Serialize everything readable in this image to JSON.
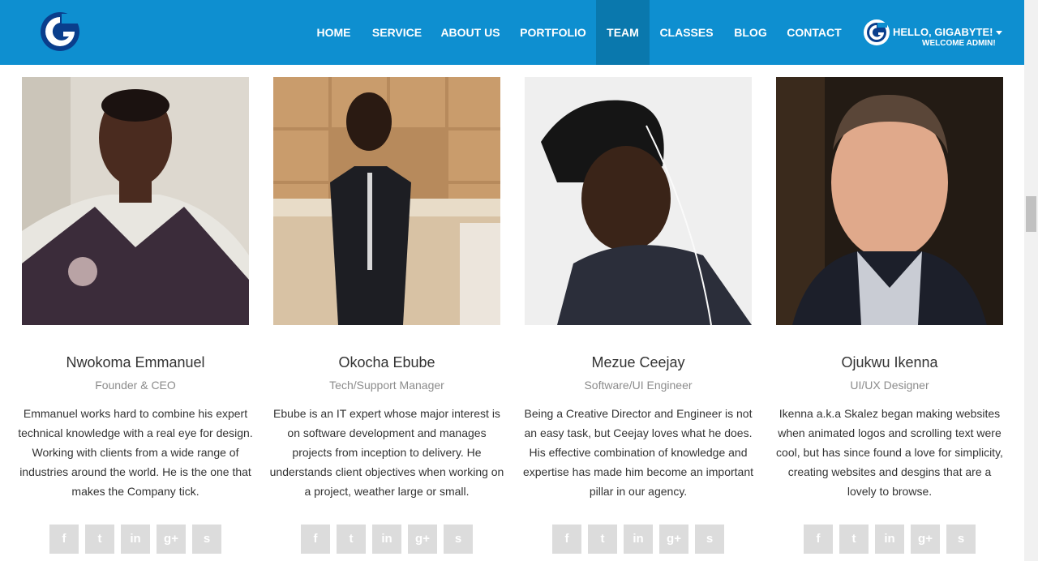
{
  "nav": {
    "items": [
      {
        "label": "HOME",
        "active": false
      },
      {
        "label": "SERVICE",
        "active": false
      },
      {
        "label": "ABOUT US",
        "active": false
      },
      {
        "label": "PORTFOLIO",
        "active": false
      },
      {
        "label": "TEAM",
        "active": true
      },
      {
        "label": "CLASSES",
        "active": false
      },
      {
        "label": "BLOG",
        "active": false
      },
      {
        "label": "CONTACT",
        "active": false
      }
    ],
    "user_hello": "HELLO, GIGABYTE!",
    "user_welcome": "WELCOME ADMIN!"
  },
  "colors": {
    "navbar": "#0e8fd0",
    "active_tab": "#0a78ad",
    "social_bg": "#dcdcdc"
  },
  "team": [
    {
      "name": "Nwokoma Emmanuel",
      "role": "Founder & CEO",
      "bio": "Emmanuel works hard to combine his expert technical knowledge with a real eye for design. Working with clients from a wide range of industries around the world. He is the one that makes the Company tick."
    },
    {
      "name": "Okocha Ebube",
      "role": "Tech/Support Manager",
      "bio": "Ebube is an IT expert whose major interest is on software development and manages projects from inception to delivery. He understands client objectives when working on a project, weather large or small."
    },
    {
      "name": "Mezue Ceejay",
      "role": "Software/UI Engineer",
      "bio": "Being a Creative Director and Engineer is not an easy task, but Ceejay loves what he does. His effective combination of knowledge and expertise has made him become an important pillar in our agency."
    },
    {
      "name": "Ojukwu Ikenna",
      "role": "UI/UX Designer",
      "bio": "Ikenna a.k.a Skalez began making websites when animated logos and scrolling text were cool, but has since found a love for simplicity, creating websites and desgins that are a lovely to browse."
    }
  ],
  "social_icons": [
    {
      "icon": "facebook-icon",
      "glyph": "f"
    },
    {
      "icon": "twitter-icon",
      "glyph": "t"
    },
    {
      "icon": "linkedin-icon",
      "glyph": "in"
    },
    {
      "icon": "google-plus-icon",
      "glyph": "g+"
    },
    {
      "icon": "skype-icon",
      "glyph": "s"
    }
  ]
}
